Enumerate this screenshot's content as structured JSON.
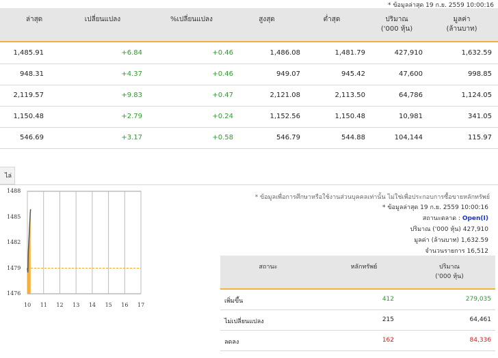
{
  "top_note": "* ข้อมูลล่าสุด 19 ก.ย. 2559 10:00:16",
  "table": {
    "headers": [
      "ล่าสุด",
      "เปลี่ยนแปลง",
      "%เปลี่ยนแปลง",
      "สูงสุด",
      "ต่ำสุด",
      "ปริมาณ\n('000 หุ้น)",
      "มูลค่า\n(ล้านบาท)"
    ],
    "rows": [
      [
        "1,485.91",
        "+6.84",
        "+0.46",
        "1,486.08",
        "1,481.79",
        "427,910",
        "1,632.59"
      ],
      [
        "948.31",
        "+4.37",
        "+0.46",
        "949.07",
        "945.42",
        "47,600",
        "998.85"
      ],
      [
        "2,119.57",
        "+9.83",
        "+0.47",
        "2,121.08",
        "2,113.50",
        "64,786",
        "1,124.05"
      ],
      [
        "1,150.48",
        "+2.79",
        "+0.24",
        "1,152.56",
        "1,150.48",
        "10,981",
        "341.05"
      ],
      [
        "546.69",
        "+3.17",
        "+0.58",
        "546.79",
        "544.88",
        "104,144",
        "115.97"
      ]
    ]
  },
  "tab_label": "ไล่",
  "disclaimer": "* ข้อมูลเพื่อการศึกษาหรือใช้งานส่วนบุคคลเท่านั้น ไม่ใช่เพื่อประกอบการซื้อขายหลักทรัพย์",
  "info": {
    "updated": "* ข้อมูลล่าสุด 19 ก.ย. 2559 10:00:16",
    "status_label": "สถานะตลาด :",
    "status_value": "Open(I)",
    "volume_label": "ปริมาณ ('000 หุ้น)",
    "volume_value": "427,910",
    "value_label": "มูลค่า (ล้านบาท)",
    "value_value": "1,632.59",
    "trades_label": "จำนวนรายการ",
    "trades_value": "16,512"
  },
  "summary": {
    "headers": [
      "สถานะ",
      "หลักทรัพย์",
      "ปริมาณ\n('000 หุ้น)"
    ],
    "rows": [
      {
        "label": "เพิ่มขึ้น",
        "count": "412",
        "volume": "279,035",
        "color": "#2d9a2d"
      },
      {
        "label": "ไม่เปลี่ยนแปลง",
        "count": "215",
        "volume": "64,461",
        "color": "#222222"
      },
      {
        "label": "ลดลง",
        "count": "162",
        "volume": "84,336",
        "color": "#d21a1a"
      }
    ]
  },
  "chart_data": {
    "type": "line",
    "yticks": [
      "1488",
      "1485",
      "1482",
      "1479",
      "1476"
    ],
    "xticks": [
      "10",
      "11",
      "12",
      "13",
      "14",
      "15",
      "16",
      "17"
    ],
    "ylim": [
      1476,
      1488
    ],
    "xlim": [
      10,
      17
    ],
    "reference_line": 1479,
    "series": [
      {
        "x": [
          10.0,
          10.03,
          10.06,
          10.1,
          10.14,
          10.18,
          10.2
        ],
        "values": [
          1479,
          1478.5,
          1481,
          1482.5,
          1484,
          1485.5,
          1485.9
        ]
      }
    ],
    "colors": {
      "line": "#555555",
      "fill": "#f5a623",
      "reference": "#f5a623"
    }
  }
}
